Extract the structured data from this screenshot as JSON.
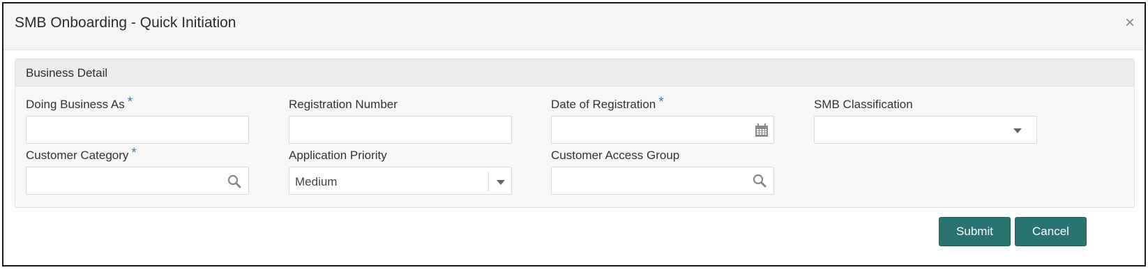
{
  "window": {
    "title": "SMB Onboarding - Quick Initiation",
    "close_glyph": "×"
  },
  "panel": {
    "title": "Business Detail"
  },
  "fields": {
    "doing_business_as": {
      "label": "Doing Business As",
      "required_mark": "*",
      "value": ""
    },
    "registration_number": {
      "label": "Registration Number",
      "value": ""
    },
    "date_of_registration": {
      "label": "Date of Registration",
      "required_mark": "*",
      "value": "",
      "icon": "calendar-icon"
    },
    "smb_classification": {
      "label": "SMB Classification",
      "value": "",
      "icon": "chevron-down-icon"
    },
    "customer_category": {
      "label": "Customer Category",
      "required_mark": "*",
      "value": "",
      "icon": "search-icon"
    },
    "application_priority": {
      "label": "Application Priority",
      "value": "Medium",
      "icon": "chevron-down-icon"
    },
    "customer_access_group": {
      "label": "Customer Access Group",
      "value": "",
      "icon": "search-icon"
    }
  },
  "buttons": {
    "submit": "Submit",
    "cancel": "Cancel"
  },
  "colors": {
    "primary_button": "#2a7470",
    "required": "#2d7fbf"
  }
}
